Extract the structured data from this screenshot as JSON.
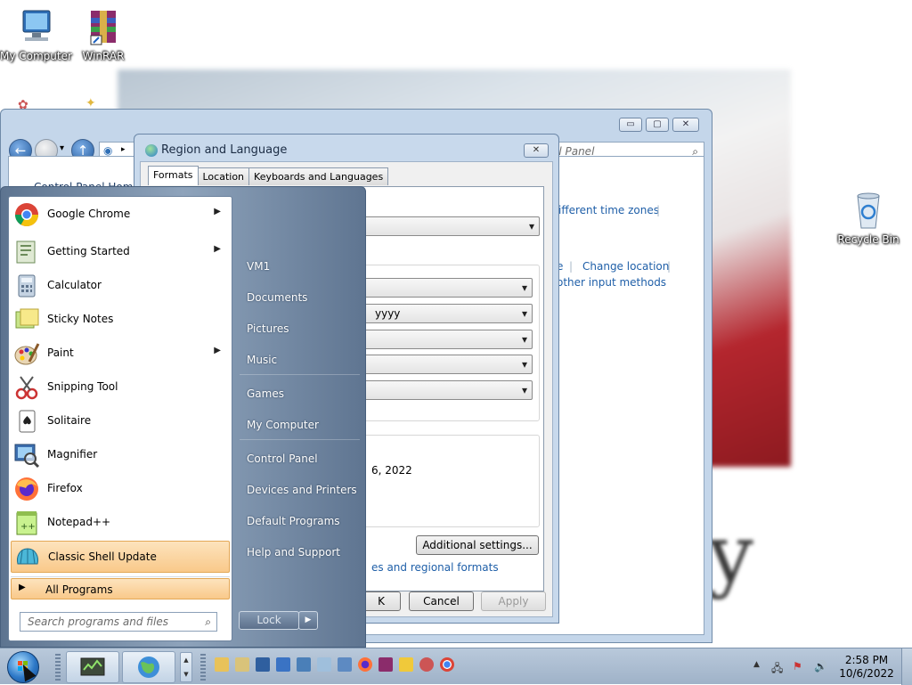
{
  "desktop": {
    "icons": [
      {
        "label": "My Computer",
        "icon": "computer-icon"
      },
      {
        "label": "WinRAR",
        "icon": "winrar-icon"
      },
      {
        "label": "Recycle Bin",
        "icon": "recycle-bin-icon"
      }
    ]
  },
  "explorer": {
    "search_placeholder": "ol Panel",
    "sidebar_home": "Control Panel Home",
    "links": [
      {
        "label": "ifferent time zones"
      },
      {
        "label": "e"
      },
      {
        "label": "Change location"
      },
      {
        "label": "other input methods"
      }
    ],
    "minimize": "▭",
    "maximize": "▢",
    "close": "✕"
  },
  "dialog": {
    "title": "Region and Language",
    "close": "✕",
    "tabs": [
      "Formats",
      "Location",
      "Keyboards and Languages"
    ],
    "date_format_partial": "yyyy",
    "date_example_partial": "6, 2022",
    "additional_settings": "Additional settings...",
    "link_partial": "es and regional formats",
    "ok": "K",
    "cancel": "Cancel",
    "apply": "Apply"
  },
  "start_menu": {
    "programs": [
      {
        "label": "Google Chrome",
        "arrow": true
      },
      {
        "label": "Getting Started",
        "arrow": true
      },
      {
        "label": "Calculator",
        "arrow": false
      },
      {
        "label": "Sticky Notes",
        "arrow": false
      },
      {
        "label": "Paint",
        "arrow": true
      },
      {
        "label": "Snipping Tool",
        "arrow": false
      },
      {
        "label": "Solitaire",
        "arrow": false
      },
      {
        "label": "Magnifier",
        "arrow": false
      },
      {
        "label": "Firefox",
        "arrow": false
      },
      {
        "label": "Notepad++",
        "arrow": false
      },
      {
        "label": "Classic Shell Update",
        "arrow": false
      }
    ],
    "all_programs": "All Programs",
    "search_placeholder": "Search programs and files",
    "places": [
      "VM1",
      "Documents",
      "Pictures",
      "Music",
      "Games",
      "My Computer",
      "Control Panel",
      "Devices and Printers",
      "Default Programs",
      "Help and Support"
    ],
    "lock": "Lock"
  },
  "taskbar": {
    "time": "2:58 PM",
    "date": "10/6/2022"
  },
  "colors": {
    "accent": "#1f5fa8",
    "highlight": "#f9c98a",
    "start_menu_bg": "#8ea3bb"
  }
}
